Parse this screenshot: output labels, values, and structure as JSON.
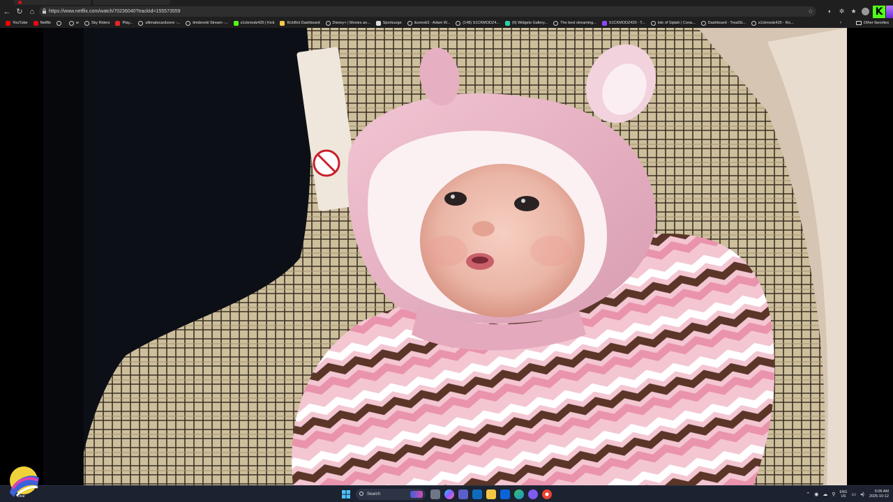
{
  "browser": {
    "url": "https://www.netflix.com/watch/70236040?trackId=155573559",
    "bookmarks": [
      {
        "label": "YouTube",
        "icon": "youtube-icon",
        "color": "#ff0000"
      },
      {
        "label": "Netflix",
        "icon": "netflix-icon",
        "color": "#e50914"
      },
      {
        "label": "",
        "icon": "globe-icon",
        "color": ""
      },
      {
        "label": "w",
        "icon": "globe-icon",
        "color": ""
      },
      {
        "label": "Sky Riders",
        "icon": "globe-icon",
        "color": ""
      },
      {
        "label": "Play...",
        "icon": "play-icon",
        "color": "#e5252a"
      },
      {
        "label": "ultimatecardzone -...",
        "icon": "globe-icon",
        "color": ""
      },
      {
        "label": "timdevoki Stream -...",
        "icon": "globe-icon",
        "color": ""
      },
      {
        "label": "s1ckmodz420 | Kick",
        "icon": "kick-icon",
        "color": "#53fc18"
      },
      {
        "label": "KickBot Dashboard",
        "icon": "kickbot-icon",
        "color": "#f7c948"
      },
      {
        "label": "Disney+ | Movies an...",
        "icon": "globe-icon",
        "color": ""
      },
      {
        "label": "Sportsurge",
        "icon": "sportsurge-icon",
        "color": "#dddddd"
      },
      {
        "label": "itzsmok3 - Adam W...",
        "icon": "globe-icon",
        "color": ""
      },
      {
        "label": "(148) S1CKMODZ4...",
        "icon": "globe-icon",
        "color": ""
      },
      {
        "label": "(6) Widgets Gallery...",
        "icon": "widgets-icon",
        "color": "#2bd1a8"
      },
      {
        "label": "The best streaming...",
        "icon": "globe-icon",
        "color": ""
      },
      {
        "label": "S1CKMODZ420 - T...",
        "icon": "twitch-icon",
        "color": "#9146ff"
      },
      {
        "label": "Isle of Siptah | Cona...",
        "icon": "globe-icon",
        "color": ""
      },
      {
        "label": "Dashboard - TreatSt...",
        "icon": "globe-icon",
        "color": ""
      },
      {
        "label": "s1ckmodz420 - Kic...",
        "icon": "globe-icon",
        "color": ""
      }
    ],
    "more_bookmarks": "›",
    "other_favorites": "Other favorites",
    "kick_logo": "K"
  },
  "video": {
    "description_icon": "netflix-video-frame"
  },
  "taskbar": {
    "weather_label": "Clear",
    "search_label": "Search",
    "lang_top": "ENG",
    "lang_bottom": "US",
    "time": "5:06 AM",
    "date": "2025-10-12",
    "colors": {
      "windows": "#4cc2ff",
      "taskbar_bg": "#1c2230"
    }
  }
}
